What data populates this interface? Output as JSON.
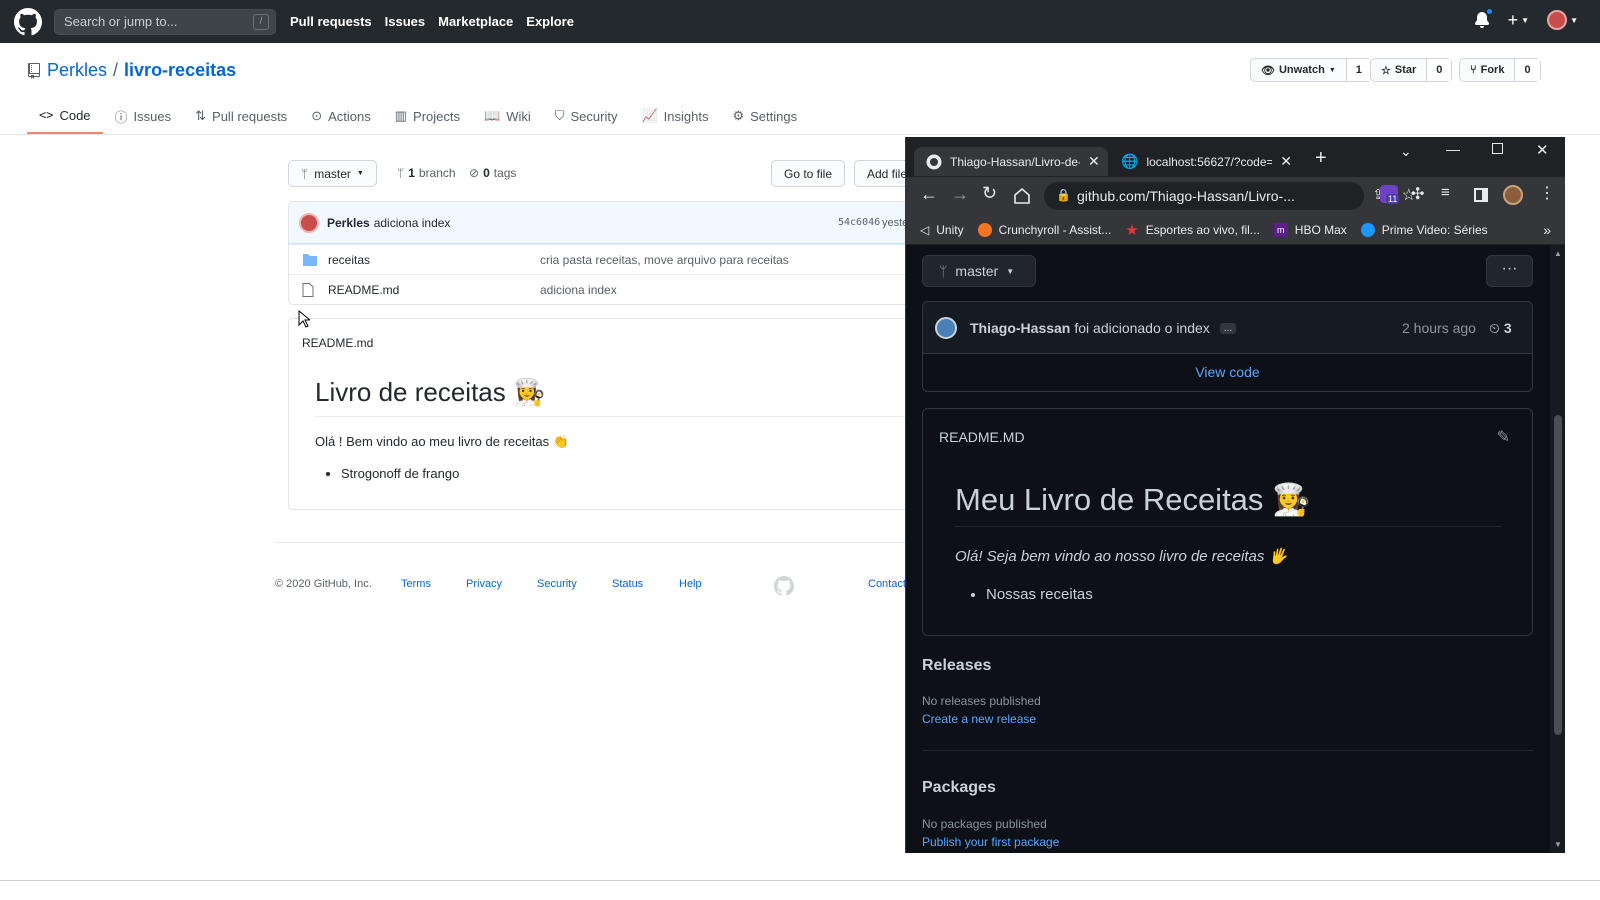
{
  "header": {
    "search_placeholder": "Search or jump to...",
    "search_hint": "/",
    "nav": [
      "Pull requests",
      "Issues",
      "Marketplace",
      "Explore"
    ]
  },
  "repo": {
    "owner": "Perkles",
    "separator": "/",
    "name": "livro-receitas",
    "unwatch_label": "Unwatch",
    "watch_count": "1",
    "star_label": "Star",
    "star_count": "0",
    "fork_label": "Fork",
    "fork_count": "0"
  },
  "tabs": [
    {
      "label": "Code",
      "icon": "code-icon",
      "selected": true
    },
    {
      "label": "Issues",
      "icon": "issue-icon"
    },
    {
      "label": "Pull requests",
      "icon": "pull-request-icon"
    },
    {
      "label": "Actions",
      "icon": "play-icon"
    },
    {
      "label": "Projects",
      "icon": "project-icon"
    },
    {
      "label": "Wiki",
      "icon": "book-icon"
    },
    {
      "label": "Security",
      "icon": "shield-icon"
    },
    {
      "label": "Insights",
      "icon": "graph-icon"
    },
    {
      "label": "Settings",
      "icon": "gear-icon"
    }
  ],
  "branch_bar": {
    "branch": "master",
    "branch_count": "1",
    "branch_word": "branch",
    "tag_count": "0",
    "tag_word": "tags",
    "goto_file": "Go to file",
    "add_file": "Add file"
  },
  "commit": {
    "author": "Perkles",
    "message": "adiciona index",
    "sha": "54c6046",
    "time": "yeste"
  },
  "files": [
    {
      "name": "receitas",
      "type": "folder",
      "message": "cria pasta receitas, move arquivo para receitas"
    },
    {
      "name": "README.md",
      "type": "file",
      "message": "adiciona index"
    }
  ],
  "readme": {
    "filename": "README.md",
    "title": "Livro de receitas 👩‍🍳",
    "intro": "Olá ! Bem vindo ao meu livro de receitas 👏",
    "items": [
      "Strogonoff de frango"
    ]
  },
  "footer": {
    "copyright": "© 2020 GitHub, Inc.",
    "links": [
      "Terms",
      "Privacy",
      "Security",
      "Status",
      "Help"
    ],
    "contact": "Contact"
  },
  "browser": {
    "tab1_title": "Thiago-Hassan/Livro-de-",
    "tab2_title": "localhost:56627/?code=",
    "url": "github.com/Thiago-Hassan/Livro-...",
    "extension_badge": "11",
    "bookmarks": [
      "Unity",
      "Crunchyroll - Assist...",
      "Esportes ao vivo, fil...",
      "HBO Max",
      "Prime Video: Séries"
    ]
  },
  "dark": {
    "branch": "master",
    "commit_author": "Thiago-Hassan",
    "commit_message": "foi adicionado o index",
    "commit_ellipsis": "...",
    "commit_time": "2 hours ago",
    "commit_count": "3",
    "view_code": "View code",
    "readme_filename": "README.MD",
    "readme_title": "Meu Livro de Receitas 👩‍🍳",
    "readme_intro": "Olá! Seja bem vindo ao nosso livro de receitas 🖐",
    "readme_items": [
      "Nossas receitas"
    ],
    "releases_heading": "Releases",
    "releases_empty": "No releases published",
    "releases_link": "Create a new release",
    "packages_heading": "Packages",
    "packages_empty": "No packages published",
    "packages_link": "Publish your first package"
  },
  "colors": {
    "gh_header": "#24292e",
    "link_blue": "#0366d6",
    "tab_underline": "#f9826c",
    "dark_bg": "#0d1117",
    "dark_link": "#58a6ff"
  }
}
